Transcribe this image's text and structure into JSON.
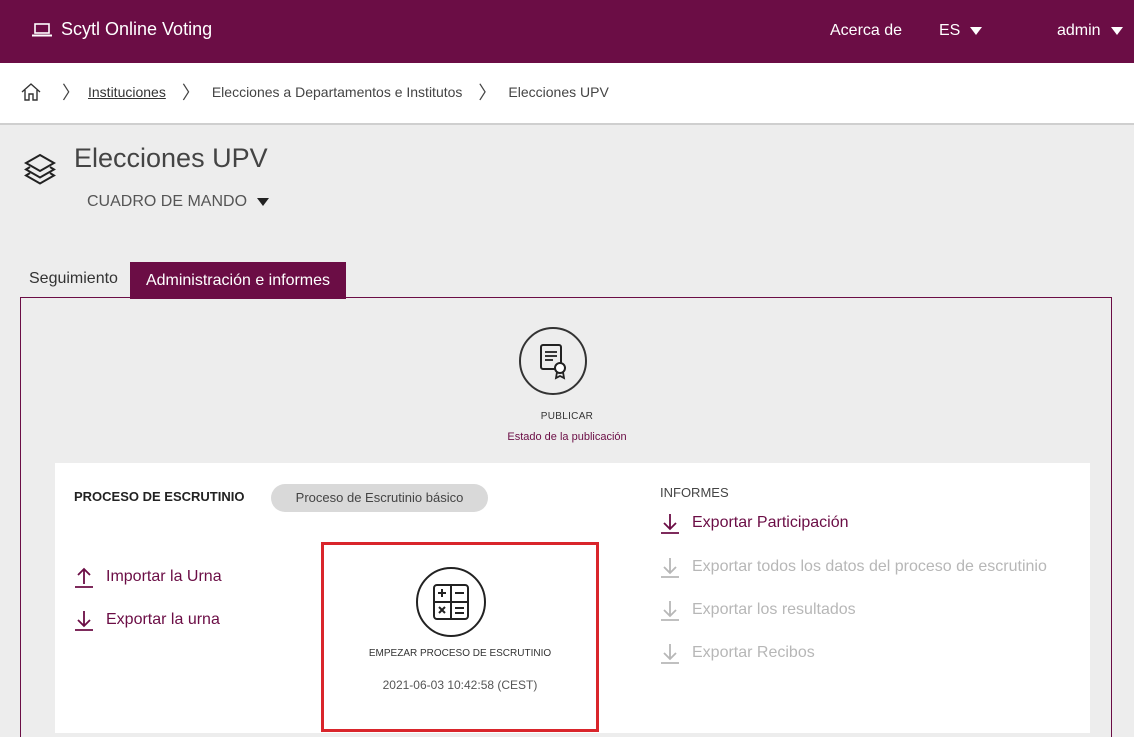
{
  "topbar": {
    "brand": "Scytl Online Voting",
    "about": "Acerca de",
    "lang": "ES",
    "user": "admin"
  },
  "breadcrumb": [
    "Instituciones",
    "Elecciones a Departamentos e Institutos",
    "Elecciones UPV"
  ],
  "page": {
    "title": "Elecciones UPV",
    "dashboard": "CUADRO DE MANDO"
  },
  "tabs": [
    "Seguimiento",
    "Administración e informes"
  ],
  "publish": {
    "label": "PUBLICAR",
    "link": "Estado de la publicación"
  },
  "scrutiny": {
    "label": "PROCESO DE ESCRUTINIO",
    "badge": "Proceso de Escrutinio básico",
    "import": "Importar la Urna",
    "export": "Exportar la urna",
    "start": "EMPEZAR PROCESO DE ESCRUTINIO",
    "date": "2021-06-03 10:42:58 (CEST)"
  },
  "reports": {
    "label": "INFORMES",
    "items": [
      "Exportar Participación",
      "Exportar todos los datos del proceso de escrutinio",
      "Exportar los resultados",
      "Exportar Recibos"
    ]
  },
  "colors": {
    "brand": "#6b0d45",
    "highlight": "#d9252b",
    "disabled": "#b7b7b7"
  }
}
